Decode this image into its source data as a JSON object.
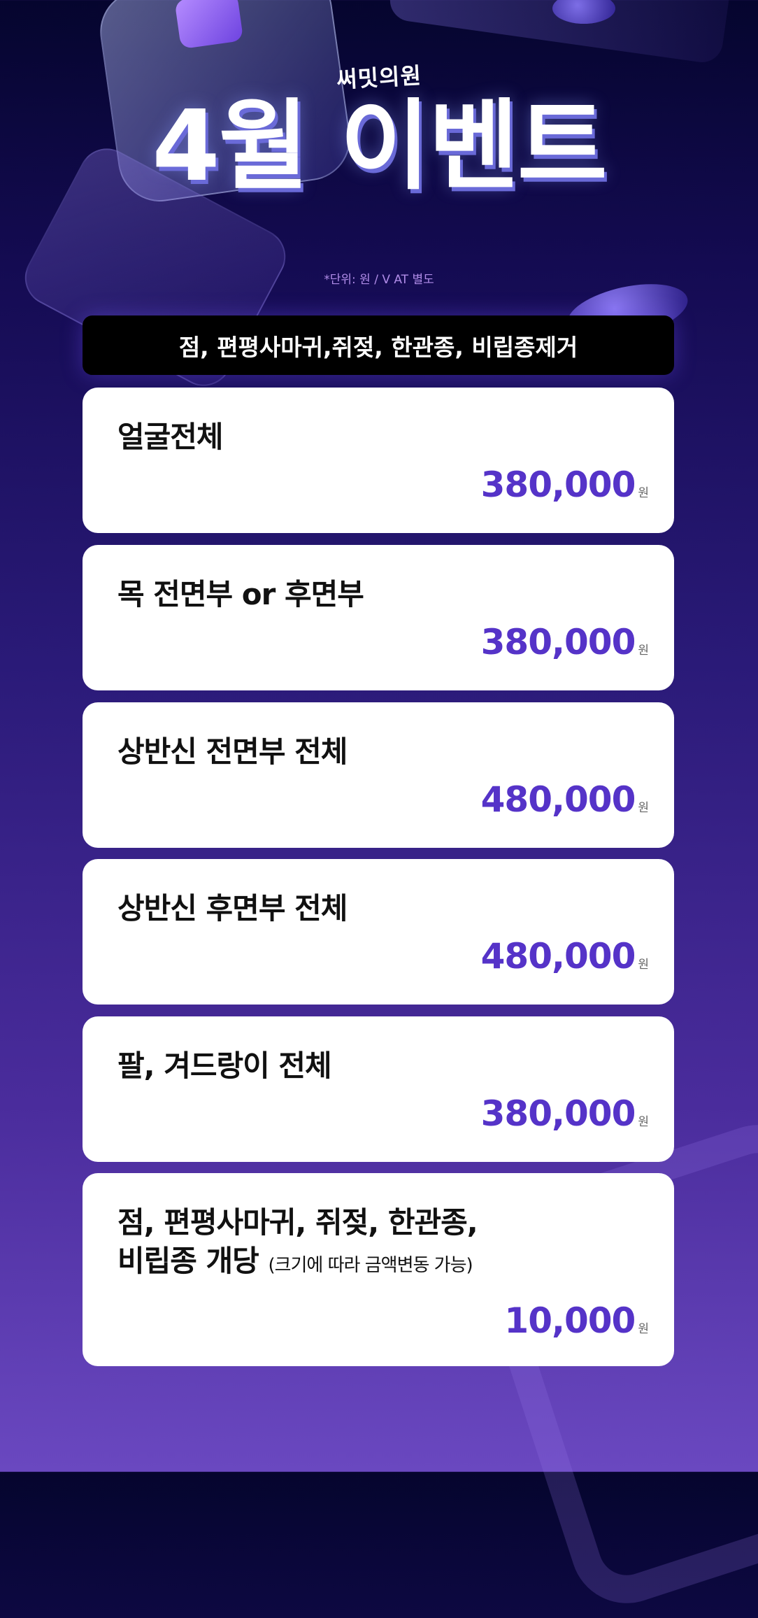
{
  "brand": "써밋의원",
  "headline": "4월 이벤트",
  "unit_note": "*단위: 원 / V AT 별도",
  "subject": "점, 편평사마귀,쥐젖, 한관종, 비립종제거",
  "currency_unit": "원",
  "accent_color": "#5533c8",
  "items": [
    {
      "title": "얼굴전체",
      "price": "380,000"
    },
    {
      "title": "목 전면부 or 후면부",
      "price": "380,000"
    },
    {
      "title": "상반신 전면부 전체",
      "price": "480,000"
    },
    {
      "title": "상반신 후면부 전체",
      "price": "480,000"
    },
    {
      "title": "팔, 겨드랑이 전체",
      "price": "380,000"
    },
    {
      "title_line1": "점, 편평사마귀, 쥐젖, 한관종,",
      "title_line2": "비립종 개당",
      "note": "(크기에 따라 금액변동 가능)",
      "price": "10,000"
    }
  ]
}
